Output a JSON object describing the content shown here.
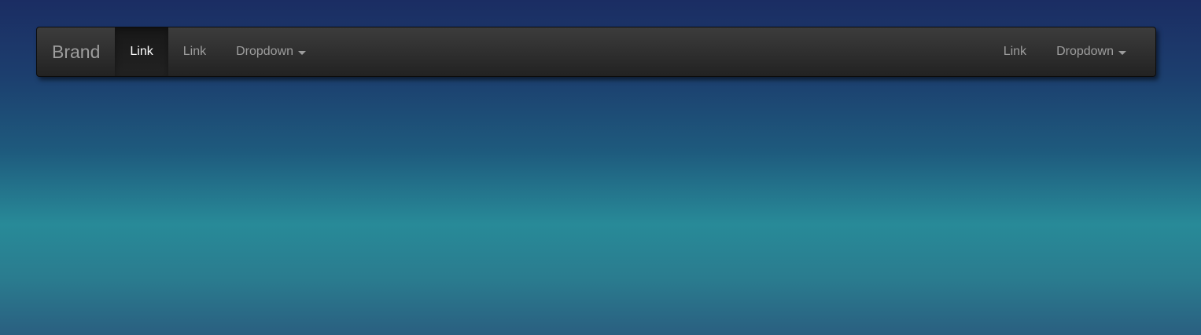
{
  "navbar": {
    "brand": "Brand",
    "left_items": [
      {
        "label": "Link",
        "active": true
      },
      {
        "label": "Link",
        "active": false
      },
      {
        "label": "Dropdown",
        "dropdown": true
      }
    ],
    "right_items": [
      {
        "label": "Link"
      },
      {
        "label": "Dropdown",
        "dropdown": true
      }
    ]
  },
  "colors": {
    "navbar_bg": "#2e2e2e",
    "link_text": "#9d9d9d",
    "active_text": "#ffffff",
    "page_top": "#1b2d63",
    "page_mid": "#288a98"
  },
  "icons": {
    "dropdown": "caret-down-icon"
  }
}
